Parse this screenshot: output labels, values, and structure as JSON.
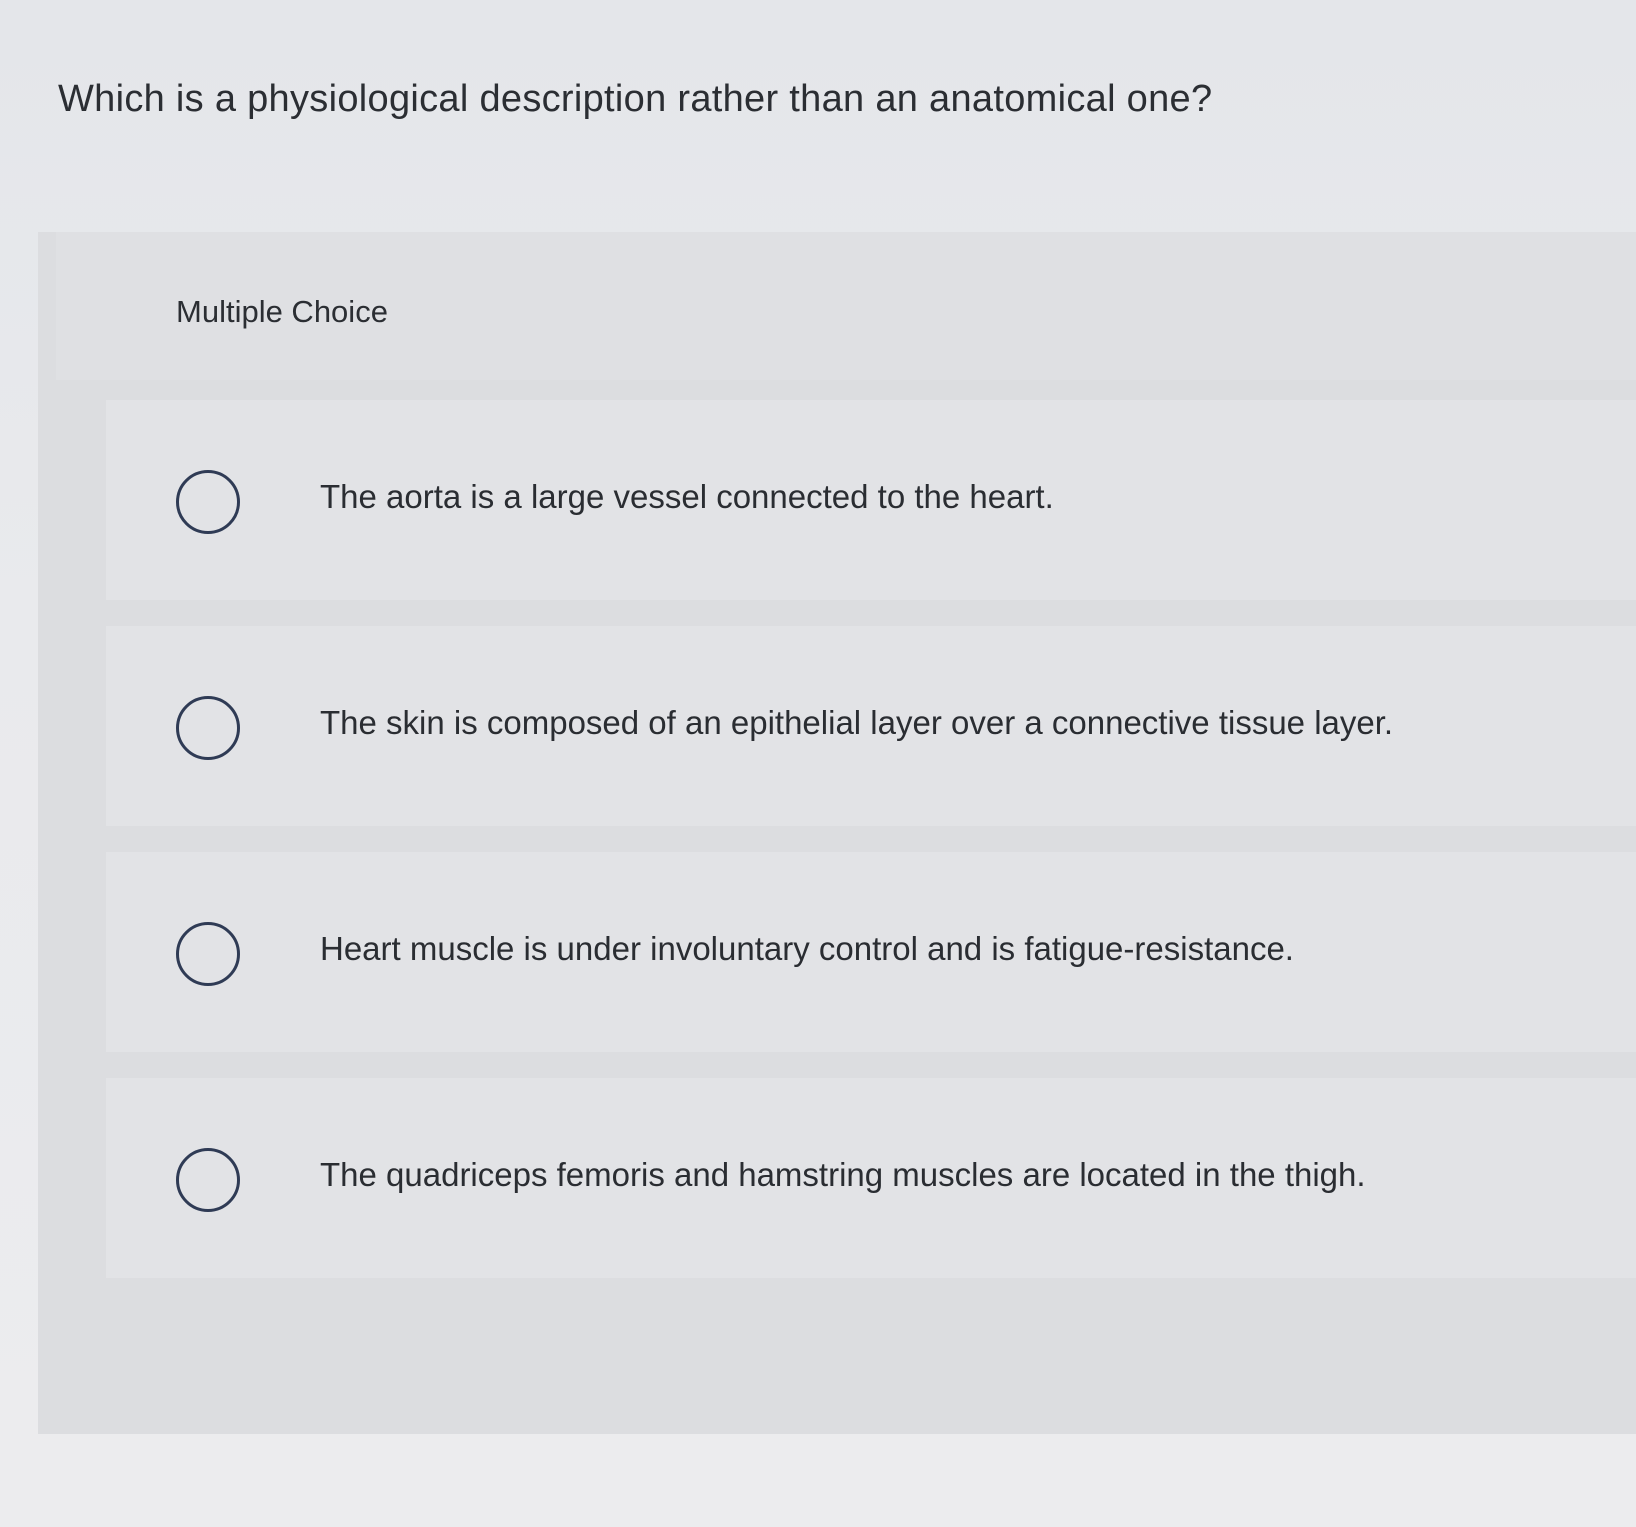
{
  "question": {
    "text": "Which is a physiological description rather than an anatomical one?"
  },
  "panel": {
    "type_label": "Multiple Choice"
  },
  "options": [
    {
      "label": "The aorta is a large vessel connected to the heart.",
      "selected": false
    },
    {
      "label": "The skin is composed of an epithelial layer over a connective tissue layer.",
      "selected": false
    },
    {
      "label": "Heart muscle is under involuntary control and is fatigue-resistance.",
      "selected": false
    },
    {
      "label": "The quadriceps femoris and hamstring muscles are located in the thigh.",
      "selected": false
    }
  ],
  "colors": {
    "radio_border": "#2f3b55",
    "text": "#2a2d32",
    "background": "#e9eaed"
  }
}
